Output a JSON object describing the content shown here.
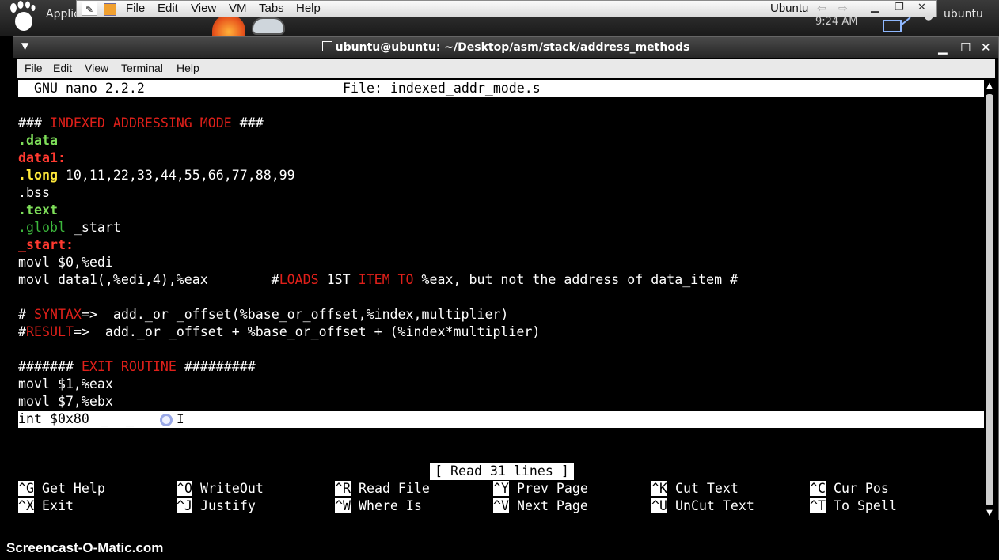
{
  "panel": {
    "apps_label": "Applic",
    "clock": "9:24 AM",
    "user": "ubuntu"
  },
  "vm_window": {
    "menu": [
      "File",
      "Edit",
      "View",
      "VM",
      "Tabs",
      "Help"
    ],
    "vm_name": "Ubuntu"
  },
  "terminal": {
    "title": "ubuntu@ubuntu: ~/Desktop/asm/stack/address_methods",
    "menu": [
      "File",
      "Edit",
      "View",
      "Terminal",
      "Help"
    ]
  },
  "nano": {
    "version": "  GNU nano 2.2.2",
    "file_label": "File: indexed_addr_mode.s",
    "status": "[ Read 31 lines ]",
    "lines": [
      [
        {
          "t": "### ",
          "c": "#ffffff"
        },
        {
          "t": "INDEXED ADDRESSING MODE",
          "c": "#e0201a"
        },
        {
          "t": " ###",
          "c": "#ffffff"
        }
      ],
      [
        {
          "t": ".data",
          "c": "#7fe05a",
          "b": true
        }
      ],
      [
        {
          "t": "data1:",
          "c": "#ff3a30",
          "b": true
        }
      ],
      [
        {
          "t": ".long",
          "c": "#ffe93a",
          "b": true
        },
        {
          "t": " 10,11,22,33,44,55,66,77,88,99",
          "c": "#ffffff"
        }
      ],
      [
        {
          "t": ".bss",
          "c": "#ffffff"
        }
      ],
      [
        {
          "t": ".text",
          "c": "#7fe05a",
          "b": true
        }
      ],
      [
        {
          "t": ".globl",
          "c": "#3cb83c"
        },
        {
          "t": " _start",
          "c": "#ffffff"
        }
      ],
      [
        {
          "t": "_start:",
          "c": "#ff3a30",
          "b": true
        }
      ],
      [
        {
          "t": "movl $0,%edi",
          "c": "#ffffff"
        }
      ],
      [
        {
          "t": "movl data1(,%edi,4),%eax        #",
          "c": "#ffffff"
        },
        {
          "t": "LOADS",
          "c": "#e0201a"
        },
        {
          "t": " 1ST ",
          "c": "#ffffff"
        },
        {
          "t": "ITEM TO",
          "c": "#e0201a"
        },
        {
          "t": " %eax, but not the address of data_item #",
          "c": "#ffffff"
        }
      ],
      [],
      [
        {
          "t": "# ",
          "c": "#ffffff"
        },
        {
          "t": "SYNTAX",
          "c": "#e0201a"
        },
        {
          "t": "=>  add._or _offset(%base_or_offset,%index,multiplier)",
          "c": "#ffffff"
        }
      ],
      [
        {
          "t": "#",
          "c": "#ffffff"
        },
        {
          "t": "RESULT",
          "c": "#e0201a"
        },
        {
          "t": "=>  add._or _offset + %base_or_offset + (%index*multiplier)",
          "c": "#ffffff"
        }
      ],
      [],
      [
        {
          "t": "####### ",
          "c": "#ffffff"
        },
        {
          "t": "EXIT ROUTINE",
          "c": "#e0201a"
        },
        {
          "t": " #########",
          "c": "#ffffff"
        }
      ],
      [
        {
          "t": "movl $1,%eax",
          "c": "#ffffff"
        }
      ],
      [
        {
          "t": "movl $7,%ebx",
          "c": "#ffffff"
        }
      ]
    ],
    "cursor_line": "int $0x80",
    "shortcuts": [
      {
        "key": "^G",
        "label": "Get Help"
      },
      {
        "key": "^O",
        "label": "WriteOut"
      },
      {
        "key": "^R",
        "label": "Read File"
      },
      {
        "key": "^Y",
        "label": "Prev Page"
      },
      {
        "key": "^K",
        "label": "Cut Text"
      },
      {
        "key": "^C",
        "label": "Cur Pos"
      },
      {
        "key": "^X",
        "label": "Exit"
      },
      {
        "key": "^J",
        "label": "Justify"
      },
      {
        "key": "^W",
        "label": "Where Is"
      },
      {
        "key": "^V",
        "label": "Next Page"
      },
      {
        "key": "^U",
        "label": "UnCut Text"
      },
      {
        "key": "^T",
        "label": "To Spell"
      }
    ]
  },
  "watermark": "Screencast-O-Matic.com"
}
